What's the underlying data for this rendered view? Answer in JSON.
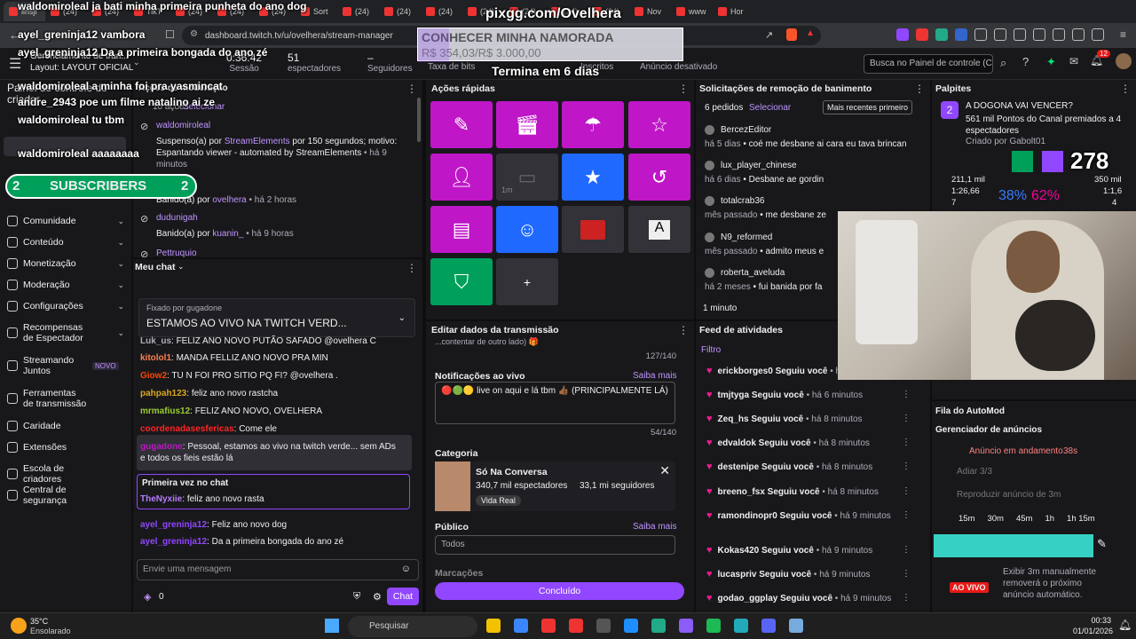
{
  "browser": {
    "tabs": [
      "linsji",
      "(24)",
      "(24)",
      "TikT",
      "(24)",
      "(24)",
      "(24)",
      "Sort",
      "(24)",
      "(24)",
      "(24)",
      "(24)",
      "(24)",
      "(24)",
      "(24)",
      "Nov",
      "www",
      "Hor"
    ],
    "url": "dashboard.twitch.tv/u/ovelhera/stream-manager"
  },
  "header": {
    "title": "Gerenciamento de tran...",
    "layout": "Layout: LAYOUT OFICIAL",
    "session_value": "0:36:42",
    "session_label": "Sessão",
    "viewers_value": "51",
    "viewers_label": "espectadores",
    "followers_value": "–",
    "followers_label": "Seguidores",
    "bits_label": "Taxa de bits",
    "subs_label": "Inscritos",
    "ad_label": "Anúncio desativado",
    "search_placeholder": "Busca no Painel de controle (C",
    "notif_count": "12"
  },
  "sidebar": {
    "title": "Painel de controle do criador",
    "items": [
      {
        "label": "Comunidade"
      },
      {
        "label": "Conteúdo"
      },
      {
        "label": "Monetização"
      },
      {
        "label": "Moderação"
      },
      {
        "label": "Configurações"
      },
      {
        "label": "Recompensas de Espectador"
      },
      {
        "label": "Streamando Juntos",
        "badge": "NOVO"
      },
      {
        "label": "Ferramentas de transmissão"
      },
      {
        "label": "Caridade"
      },
      {
        "label": "Extensões"
      },
      {
        "label": "Escola de criadores"
      },
      {
        "label": "Central de segurança"
      }
    ]
  },
  "mod_actions": {
    "count_label": "10 ações",
    "select": "Selecionar",
    "entries": [
      {
        "user": "waldomiroleal",
        "text_prefix": "Suspenso(a) por",
        "by": "StreamElements",
        "text_suffix": "por 150 segundos; motivo: Espantando viewer - automated by StreamElements",
        "time": "• há 9 minutos"
      },
      {
        "user": "...nda",
        "text_prefix": "Banido(a) por",
        "by": "ovelhera",
        "time": "• há 2 horas"
      },
      {
        "user": "dudunigah",
        "text_prefix": "Banido(a) por",
        "by": "kuanin_",
        "time": "• há 9 horas"
      },
      {
        "user": "Pettruquio",
        "text_prefix": "",
        "by": "",
        "time": ""
      }
    ]
  },
  "chat": {
    "title": "Meu chat",
    "pinned_by": "Fixado por gugadone",
    "pinned_text": "ESTAMOS AO VIVO NA TWITCH VERD...",
    "messages": [
      {
        "user": "Luk_us",
        "color": "#adadb8",
        "text": "FELIZ ANO NOVO PUTÃO SAFADO @ovelhera C"
      },
      {
        "user": "kitolol1",
        "color": "#ff7f50",
        "text": "MANDA FELLIZ ANO NOVO PRA MIN"
      },
      {
        "user": "Giow2",
        "color": "#ff4500",
        "text": "TU N FOI PRO SITIO PQ FI? @ovelhera ."
      },
      {
        "user": "pahpah123",
        "color": "#daa520",
        "text": "feliz ano novo rastcha"
      },
      {
        "user": "mrmafius12",
        "color": "#9acd32",
        "text": "FELIZ ANO NOVO, OVELHERA"
      },
      {
        "user": "coordenadasesfericas",
        "color": "#ff2424",
        "text": "Come ele"
      },
      {
        "user": "gugadone",
        "color": "#bf16c8",
        "text": "Pessoal, estamos ao vivo na twitch verde... sem ADs e todos os fieis estão lá"
      },
      {
        "user": "TheNyxiie",
        "color": "#b77bff",
        "text": "feliz ano novo rasta"
      },
      {
        "user": "ayel_greninja12",
        "color": "#9147ff",
        "text": "Feliz ano novo dog"
      },
      {
        "user": "ayel_greninja12",
        "color": "#9147ff",
        "text": "Da a primeira bongada do ano zé"
      }
    ],
    "first_time_label": "Primeira vez no chat",
    "input_placeholder": "Envie uma mensagem",
    "points": "0",
    "chat_button": "Chat"
  },
  "quick_actions": {
    "title": "Ações rápidas",
    "add": "+",
    "cooldown": "1m"
  },
  "stream_info": {
    "title": "Editar dados da transmissão",
    "title_counter": "127/140",
    "title_snippet": "...contentar de outro lado) 🎁",
    "notif_label": "Notificações ao vivo",
    "learn_more": "Saiba mais",
    "notif_text": "🔴🟢🟡 live on aqui e lá tbm 👍🏾 (PRINCIPALMENTE LÁ)",
    "notif_counter": "54/140",
    "category_label": "Categoria",
    "category_name": "Só Na Conversa",
    "category_viewers": "340,7 mil espectadores",
    "category_followers": "33,1 mi seguidores",
    "category_tag": "Vida Real",
    "audience_label": "Público",
    "audience_value": "Todos",
    "tags_label": "Marcações",
    "done_button": "Concluído"
  },
  "unban": {
    "title": "Solicitações de remoção de banimento",
    "count": "6 pedidos",
    "select": "Selecionar",
    "sort": "Mais recentes primeiro",
    "requests": [
      {
        "user": "BercezEditor",
        "time": "há 5 dias",
        "text": "• coé me desbane ai cara eu tava brincan"
      },
      {
        "user": "lux_player_chinese",
        "time": "há 6 dias",
        "text": "• Desbane ae gordin"
      },
      {
        "user": "totalcrab36",
        "time": "mês passado",
        "text": "• me desbane ze"
      },
      {
        "user": "N9_reformed",
        "time": "mês passado",
        "text": "• admito meus e"
      },
      {
        "user": "roberta_aveluda",
        "time": "há 2 meses",
        "text": "• fui banida por fa"
      }
    ],
    "timer": "1 minuto"
  },
  "activity": {
    "title": "Feed de atividades",
    "filter": "Filtro",
    "items": [
      {
        "user": "erickborges0",
        "text": "Seguiu você",
        "time": "• há"
      },
      {
        "user": "tmjtyga",
        "text": "Seguiu você",
        "time": "• há 6 minutos"
      },
      {
        "user": "Zeq_hs",
        "text": "Seguiu você",
        "time": "• há 8 minutos"
      },
      {
        "user": "edvaldok",
        "text": "Seguiu você",
        "time": "• há 8 minutos"
      },
      {
        "user": "destenipe",
        "text": "Seguiu você",
        "time": "• há 8 minutos"
      },
      {
        "user": "breeno_fsx",
        "text": "Seguiu você",
        "time": "• há 8 minutos"
      },
      {
        "user": "ramondinopr0",
        "text": "Seguiu você",
        "time": "• há 9 minutos"
      },
      {
        "user": "Kokas420",
        "text": "Seguiu você",
        "time": "• há 9 minutos"
      },
      {
        "user": "lucaspriv",
        "text": "Seguiu você",
        "time": "• há 9 minutos"
      },
      {
        "user": "godao_ggplay",
        "text": "Seguiu você",
        "time": "• há 9 minutos"
      }
    ]
  },
  "predictions": {
    "title": "Palpites",
    "question": "A DOGONA VAI VENCER?",
    "points": "561 mil Pontos do Canal premiados a 4 espectadores",
    "created": "Criado por Gabolt01",
    "left_points": "211,1 mil",
    "left_ratio": "1:26,66",
    "left_count": "7",
    "left_pct": "38%",
    "right_pct": "62%",
    "right_points": "350 mil",
    "right_ratio": "1:1,6",
    "right_count": "4"
  },
  "automod": {
    "title": "Fila do AutoMod"
  },
  "ads": {
    "title": "Gerenciador de anúncios",
    "running": "Anúncio em andamento",
    "running_time": "38s",
    "snooze": "Adiar 3/3",
    "replay": "Reproduzir anúncio de 3m",
    "scale": [
      "15m",
      "30m",
      "45m",
      "1h",
      "1h 15m"
    ],
    "live": "AO VIVO",
    "info": "Exibir 3m manualmente removerá o próximo anúncio automático."
  },
  "overlay": {
    "site": "pixgg.com/Ovelhera",
    "goal_title": "CONHECER MINHA NAMORADA",
    "goal_progress": "R$ 354,03/R$ 3.000,00",
    "goal_fraction": 0.118,
    "goal_deadline": "Termina em 6 dias",
    "subs_label": "SUBSCRIBERS",
    "subs_count": "2",
    "counter": "278",
    "chat": [
      {
        "user": "waldomiroleal",
        "text": "ja bati minha primeira punheta do ano dog"
      },
      {
        "user": "ayel_greninja12",
        "text": "vambora"
      },
      {
        "user": "ayel_greninja12",
        "text": "Da a primeira bongada do ano zé"
      },
      {
        "user": "waldomiroleal",
        "text": "a minha foi pra yasmincat"
      },
      {
        "user": "andre_2943",
        "text": "poe um filme natalino ai ze"
      },
      {
        "user": "waldomiroleal",
        "text": "tu tbm"
      },
      {
        "user": "waldomiroleal",
        "text": "aaaaaaaa"
      }
    ]
  },
  "taskbar": {
    "temp": "35°C",
    "weather": "Ensolarado",
    "search": "Pesquisar",
    "time": "00:33",
    "date": "01/01/2026"
  },
  "colors": {
    "accent": "#9147ff",
    "magenta": "#bf16c8",
    "blue": "#1f69ff",
    "green": "#00a05b",
    "teal": "#36d1c4"
  }
}
